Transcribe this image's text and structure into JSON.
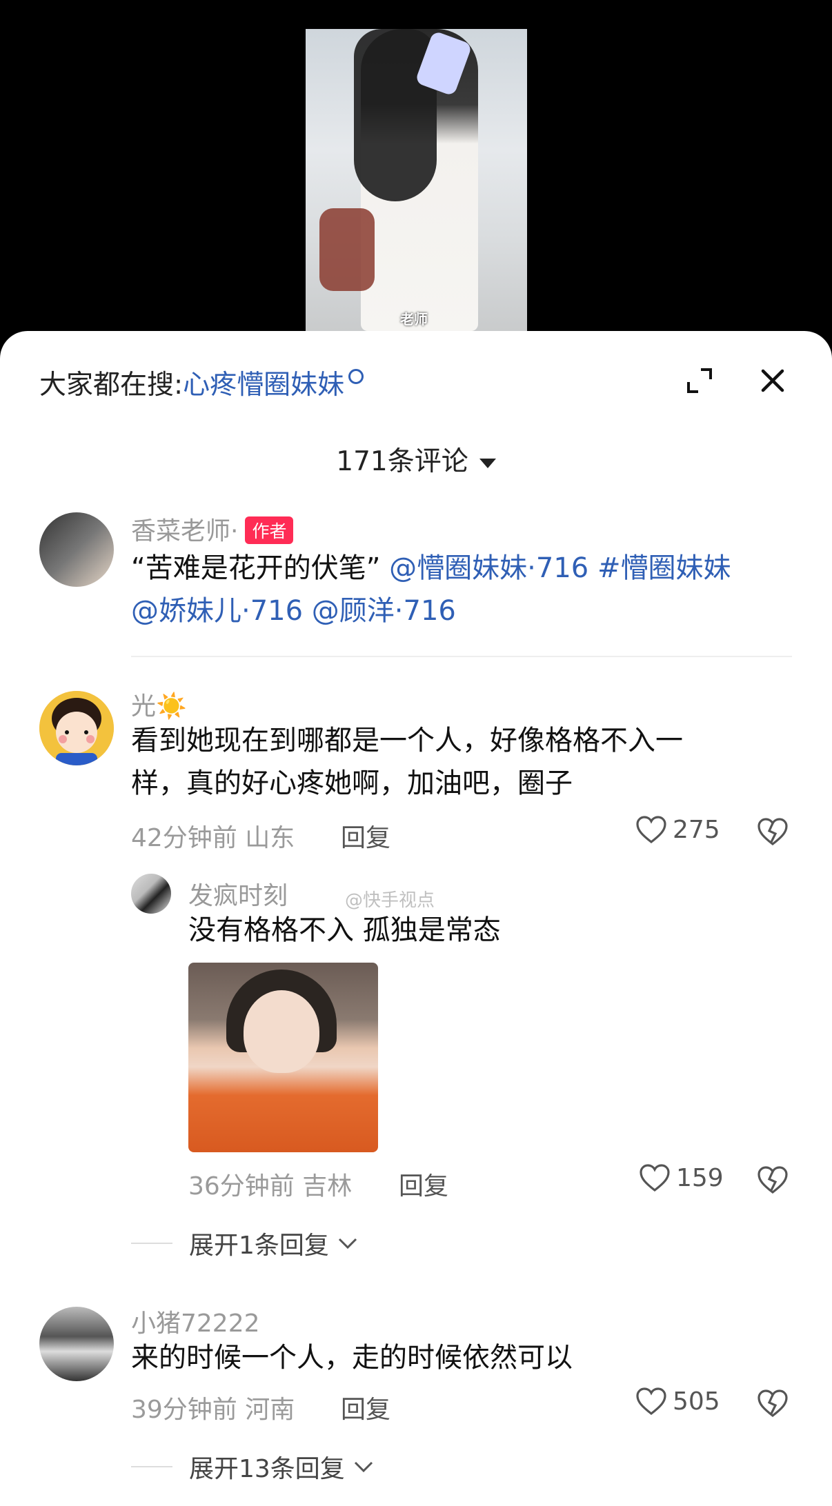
{
  "video": {
    "caption": "老师"
  },
  "header": {
    "search_prefix": "大家都在搜:",
    "search_query": "心疼懵圈妹妹",
    "expand_icon": "expand-icon",
    "close_icon": "close-icon"
  },
  "comments_count": "171条评论",
  "watermark": "@快手视点",
  "comments": [
    {
      "username": "香菜老师·",
      "badge": "作者",
      "text_plain": "“苦难是花开的伏笔” ",
      "links_line1": "@懵圈妹妹·716 #懵圈妹妹",
      "links_line2": "@娇妹儿·716 @顾洋·716"
    },
    {
      "username": "光☀️",
      "text_line1": "看到她现在到哪都是一个人，好像格格不入一",
      "text_line2": "样，真的好心疼她啊，加油吧，圈子",
      "meta": "42分钟前 山东",
      "reply": "回复",
      "likes": "275",
      "replies": [
        {
          "username": "发疯时刻",
          "text": "没有格格不入 孤独是常态",
          "meta": "36分钟前 吉林",
          "reply": "回复",
          "likes": "159"
        }
      ],
      "expand": "展开1条回复"
    },
    {
      "username": "小猪72222",
      "text": "来的时候一个人，走的时候依然可以",
      "meta": "39分钟前 河南",
      "reply": "回复",
      "likes": "505",
      "expand": "展开13条回复"
    }
  ],
  "colors": {
    "link": "#2f5fb5",
    "badge": "#ff2c55"
  }
}
